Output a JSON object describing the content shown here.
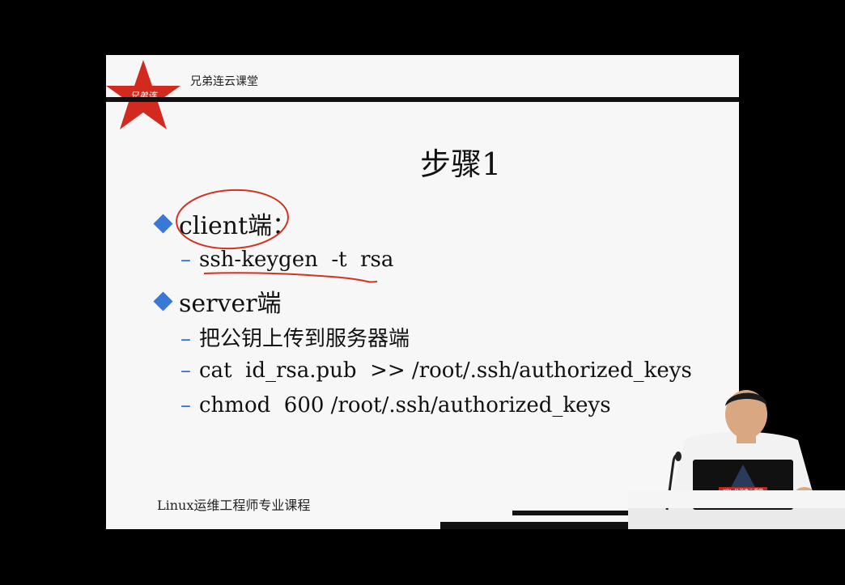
{
  "slide": {
    "brand": "兄弟连云课堂",
    "logo_text": "兄弟连",
    "title": "步骤1",
    "bullets": [
      {
        "label": "client端：",
        "subitems": [
          "ssh-keygen  -t  rsa"
        ]
      },
      {
        "label": "server端",
        "subitems": [
          "把公钥上传到服务器端",
          "cat  id_rsa.pub  >> /root/.ssh/authorized_keys",
          "chmod  600 /root/.ssh/authorized_keys"
        ]
      }
    ],
    "footer": "Linux运维工程师专业课程"
  },
  "presenter": {
    "laptop_logo": "XDL 兄弟连云课堂"
  },
  "colors": {
    "bullet": "#3a78d8",
    "dash": "#2e6bd3",
    "star": "#d22a1e",
    "annotation": "#d6311f"
  }
}
